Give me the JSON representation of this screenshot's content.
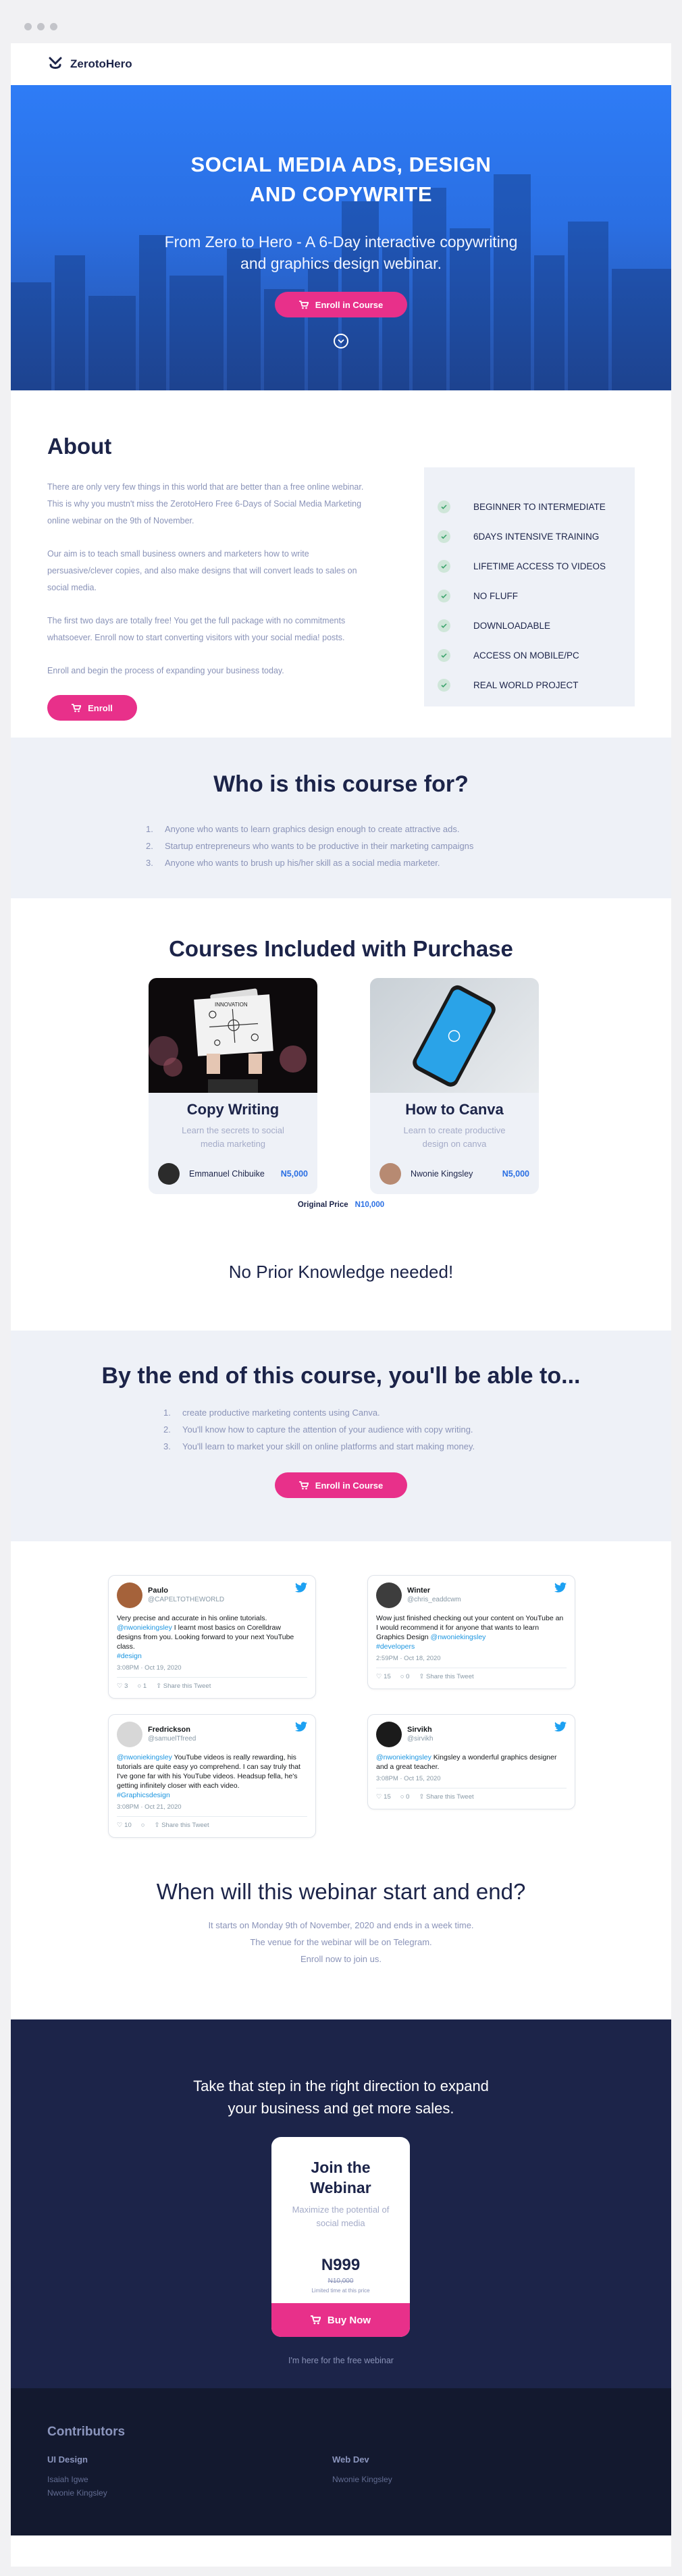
{
  "brand": {
    "name": "ZerotoHero"
  },
  "hero": {
    "title_line1": "SOCIAL MEDIA ADS, DESIGN",
    "title_line2": "AND COPYWRITE",
    "subtitle_line1": "From Zero to Hero - A 6-Day interactive copywriting",
    "subtitle_line2": "and graphics design webinar.",
    "cta_label": "Enroll in Course"
  },
  "about": {
    "heading": "About",
    "paragraphs": [
      "There are only very few things in this world that are better than a free online webinar. This is why you mustn't miss the ZerotoHero Free 6-Days of Social Media Marketing online webinar on the 9th of November.",
      "Our aim is to teach small business owners and marketers how to write persuasive/clever copies, and also make designs that will convert leads to sales on social media.",
      "The first two days are totally free! You get the full package with no commitments whatsoever. Enroll now to start converting visitors with your social media! posts.",
      "Enroll and begin the process of expanding your business today."
    ],
    "cta_label": "Enroll",
    "features": [
      "BEGINNER TO INTERMEDIATE",
      "6DAYS INTENSIVE TRAINING",
      "LIFETIME ACCESS TO VIDEOS",
      "NO FLUFF",
      "DOWNLOADABLE",
      "ACCESS ON MOBILE/PC",
      "REAL WORLD PROJECT"
    ]
  },
  "audience": {
    "heading": "Who is this course for?",
    "items": [
      "Anyone who wants to learn graphics design enough to create attractive ads.",
      "Startup entrepreneurs who wants to be productive in their marketing campaigns",
      "Anyone who wants to brush up his/her skill as a social media marketer."
    ]
  },
  "courses": {
    "heading": "Courses Included with Purchase",
    "items": [
      {
        "title": "Copy Writing",
        "desc": "Learn the secrets to social media marketing",
        "author": "Emmanuel Chibuike",
        "price": "N5,000",
        "img_text": "INNOVATION"
      },
      {
        "title": "How to Canva",
        "desc": "Learn to create productive design on canva",
        "author": "Nwonie Kingsley",
        "price": "N5,000"
      }
    ],
    "original_price_label": "Original Price",
    "original_price": "N10,000"
  },
  "no_prior": "No Prior Knowledge needed!",
  "outcomes": {
    "heading": "By the end of this course, you'll be able to...",
    "items": [
      "create productive marketing contents using Canva.",
      "You'll know how to capture the attention of your audience with copy writing.",
      "You'll learn to market your skill on online platforms and start making money."
    ],
    "cta_label": "Enroll in Course"
  },
  "tweets": [
    {
      "name": "Paulo",
      "handle": "@CAPELTOTHEWORLD",
      "pre": "Very precise and accurate in his online tutorials.",
      "mention": "@nwoniekingsley",
      "post": "I learnt most basics on Corelldraw designs from you. Looking forward to your next YouTube class.",
      "tag": "#design",
      "time": "3:08PM · Oct 19, 2020",
      "likes": "3",
      "replies": "1",
      "share": "Share this Tweet"
    },
    {
      "name": "Winter",
      "handle": "@chris_eaddcwm",
      "pre": "Wow just finished checking out your content on YouTube an I would recommend it for anyone that wants to learn Graphics Design",
      "mention": "@nwoniekingsley",
      "post": "",
      "tag": "#developers",
      "time": "2:59PM · Oct 18, 2020",
      "likes": "15",
      "replies": "0",
      "share": "Share this Tweet"
    },
    {
      "name": "Fredrickson",
      "handle": "@samuelTfreed",
      "pre": "",
      "mention": "@nwoniekingsley",
      "post": "YouTube videos is really rewarding, his tutorials are quite easy yo comprehend. I can say truly that I've gone far with his YouTube videos. Headsup fella, he's getting infinitely closer with each video.",
      "tag": "#Graphicsdesign",
      "time": "3:08PM · Oct 21, 2020",
      "likes": "10",
      "replies": "",
      "share": "Share this Tweet"
    },
    {
      "name": "Sirvikh",
      "handle": "@sirvikh",
      "pre": "",
      "mention": "@nwoniekingsley",
      "post": "Kingsley a wonderful graphics designer and a great teacher.",
      "tag": "",
      "time": "3:08PM · Oct 15, 2020",
      "likes": "15",
      "replies": "0",
      "share": "Share this Tweet"
    }
  ],
  "schedule": {
    "heading": "When will this webinar start and end?",
    "lines": [
      "It starts on Monday 9th of November, 2020 and ends in a week time.",
      "The venue for the webinar will be on Telegram.",
      "Enroll now to join us."
    ]
  },
  "cta": {
    "heading_line1": "Take that step in the right direction to expand",
    "heading_line2": "your business and get more sales.",
    "plan_title_line1": "Join the",
    "plan_title_line2": "Webinar",
    "plan_desc": "Maximize the potential of social media",
    "amount": "N999",
    "old_amount": "N10,000",
    "limited": "Limited time at this price",
    "buy_label": "Buy Now",
    "free_link": "I'm here for the free webinar"
  },
  "footer": {
    "heading": "Contributors",
    "groups": [
      {
        "title": "UI Design",
        "names": [
          "Isaiah Igwe",
          "Nwonie Kingsley"
        ]
      },
      {
        "title": "Web Dev",
        "names": [
          "Nwonie Kingsley"
        ]
      }
    ]
  },
  "colors": {
    "accent": "#e8308a",
    "brand_blue": "#2a6fe3",
    "navy": "#1c2449"
  }
}
